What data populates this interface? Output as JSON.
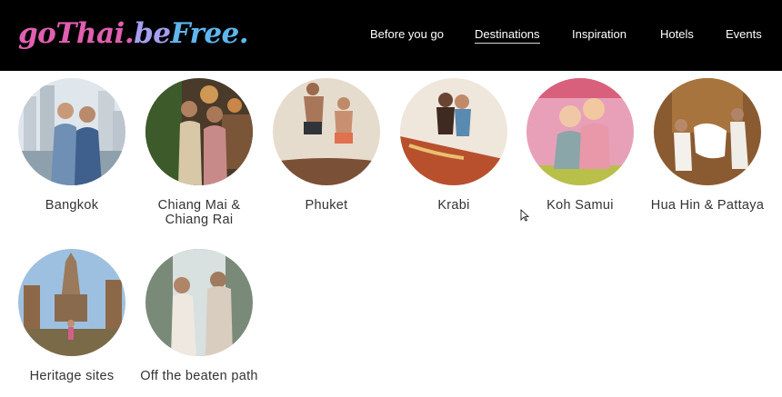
{
  "brand": {
    "logo_part1": "goThai.",
    "logo_part2": "be",
    "logo_part3": "Free."
  },
  "nav": {
    "items": [
      {
        "label": "Before you go"
      },
      {
        "label": "Destinations"
      },
      {
        "label": "Inspiration"
      },
      {
        "label": "Hotels"
      },
      {
        "label": "Events"
      }
    ],
    "active": "Destinations"
  },
  "destinations": [
    {
      "label": "Bangkok",
      "icon": "city-skyline-photo"
    },
    {
      "label": "Chiang Mai & Chiang Rai",
      "icon": "night-market-photo"
    },
    {
      "label": "Phuket",
      "icon": "boat-dancing-photo"
    },
    {
      "label": "Krabi",
      "icon": "longtail-boat-photo"
    },
    {
      "label": "Koh Samui",
      "icon": "tuk-tuk-selfie-photo"
    },
    {
      "label": "Hua Hin & Pattaya",
      "icon": "hotel-pillow-fight-photo"
    },
    {
      "label": "Heritage sites",
      "icon": "temple-ruins-photo"
    },
    {
      "label": "Off the beaten path",
      "icon": "waterfall-photo"
    }
  ],
  "colors": {
    "topbar": "#000000",
    "logo_pink": "#e05fb0",
    "logo_lilac": "#a6a0f0",
    "logo_blue": "#5fb6ee",
    "label_text": "#333333"
  }
}
